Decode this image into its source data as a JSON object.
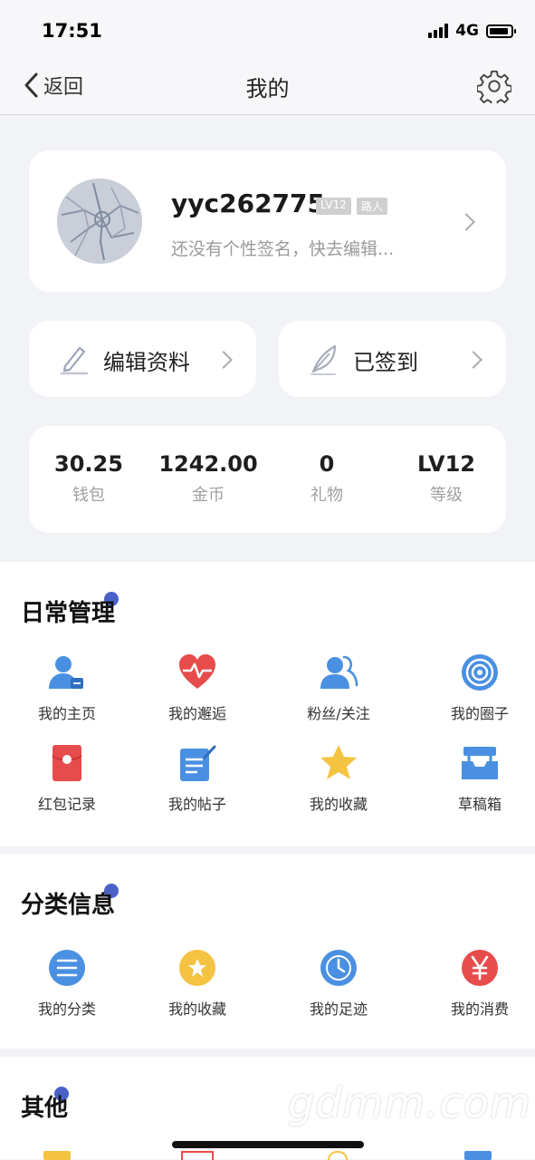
{
  "status": {
    "time": "17:51",
    "network": "4G"
  },
  "nav": {
    "back_label": "返回",
    "title": "我的"
  },
  "profile": {
    "username": "yyc262775",
    "level_badge": "LV12",
    "role_badge": "路人",
    "signature": "还没有个性签名，快去编辑..."
  },
  "actions": {
    "edit_label": "编辑资料",
    "signin_label": "已签到"
  },
  "stats": [
    {
      "value": "30.25",
      "label": "钱包"
    },
    {
      "value": "1242.00",
      "label": "金币"
    },
    {
      "value": "0",
      "label": "礼物"
    },
    {
      "value": "LV12",
      "label": "等级"
    }
  ],
  "daily": {
    "title": "日常管理",
    "items": [
      {
        "label": "我的主页",
        "icon": "user-home-icon"
      },
      {
        "label": "我的邂逅",
        "icon": "heart-pulse-icon"
      },
      {
        "label": "粉丝/关注",
        "icon": "fans-icon"
      },
      {
        "label": "我的圈子",
        "icon": "circle-icon"
      },
      {
        "label": "红包记录",
        "icon": "red-envelope-icon"
      },
      {
        "label": "我的帖子",
        "icon": "post-icon"
      },
      {
        "label": "我的收藏",
        "icon": "star-icon"
      },
      {
        "label": "草稿箱",
        "icon": "drafts-icon"
      }
    ]
  },
  "category": {
    "title": "分类信息",
    "items": [
      {
        "label": "我的分类",
        "icon": "list-icon"
      },
      {
        "label": "我的收藏",
        "icon": "star-box-icon"
      },
      {
        "label": "我的足迹",
        "icon": "clock-icon"
      },
      {
        "label": "我的消费",
        "icon": "yen-icon"
      }
    ]
  },
  "other": {
    "title": "其他"
  },
  "watermark": "gdmm.com",
  "colors": {
    "blue": "#4a90e2",
    "red": "#e74c4c",
    "yellow": "#f5c342",
    "accent_dot": "#4a62c7"
  }
}
